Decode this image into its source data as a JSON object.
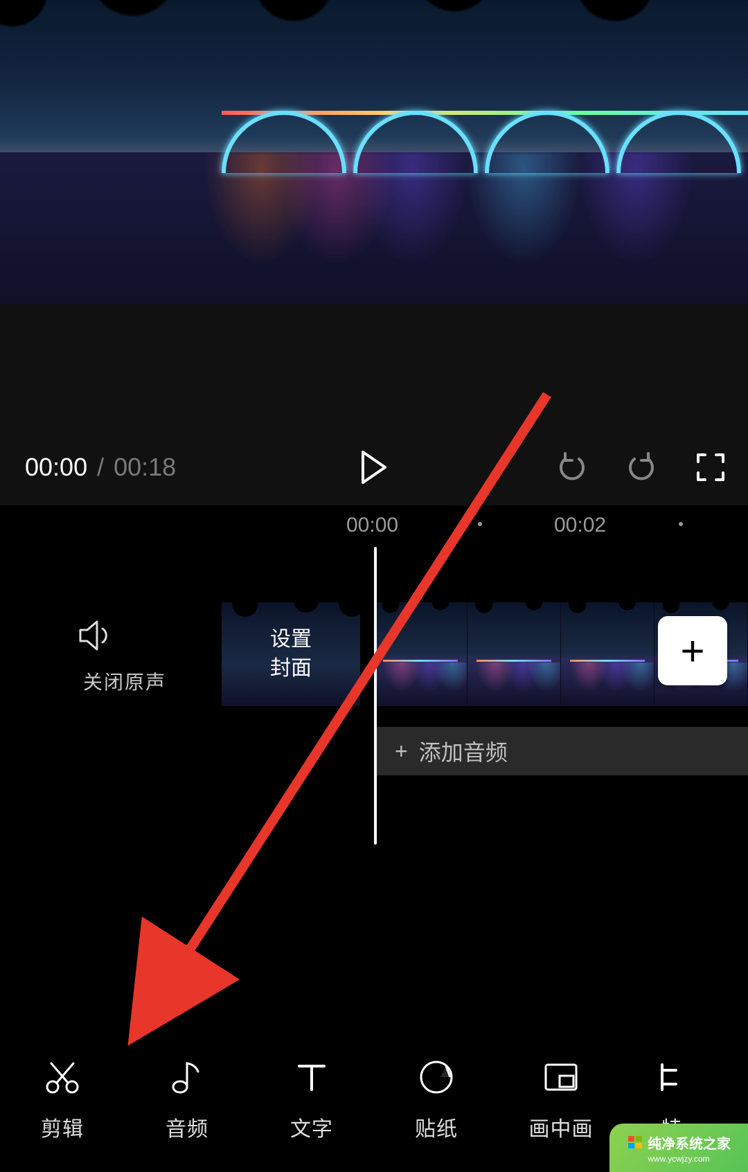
{
  "player": {
    "current_time": "00:00",
    "separator": "/",
    "total_time": "00:18"
  },
  "ruler": {
    "marks": [
      "00:00",
      "00:02"
    ]
  },
  "mute": {
    "label": "关闭原声"
  },
  "cover": {
    "line1": "设置",
    "line2": "封面"
  },
  "audio_row": {
    "plus": "+",
    "label": "添加音频"
  },
  "add_button": {
    "symbol": "+"
  },
  "toolbar": [
    {
      "id": "cut",
      "label": "剪辑"
    },
    {
      "id": "audio",
      "label": "音频"
    },
    {
      "id": "text",
      "label": "文字"
    },
    {
      "id": "sticker",
      "label": "贴纸"
    },
    {
      "id": "pip",
      "label": "画中画"
    },
    {
      "id": "more",
      "label": "特"
    }
  ],
  "watermark": {
    "text": "纯净系统之家",
    "url": "www.ycwjzy.com"
  }
}
